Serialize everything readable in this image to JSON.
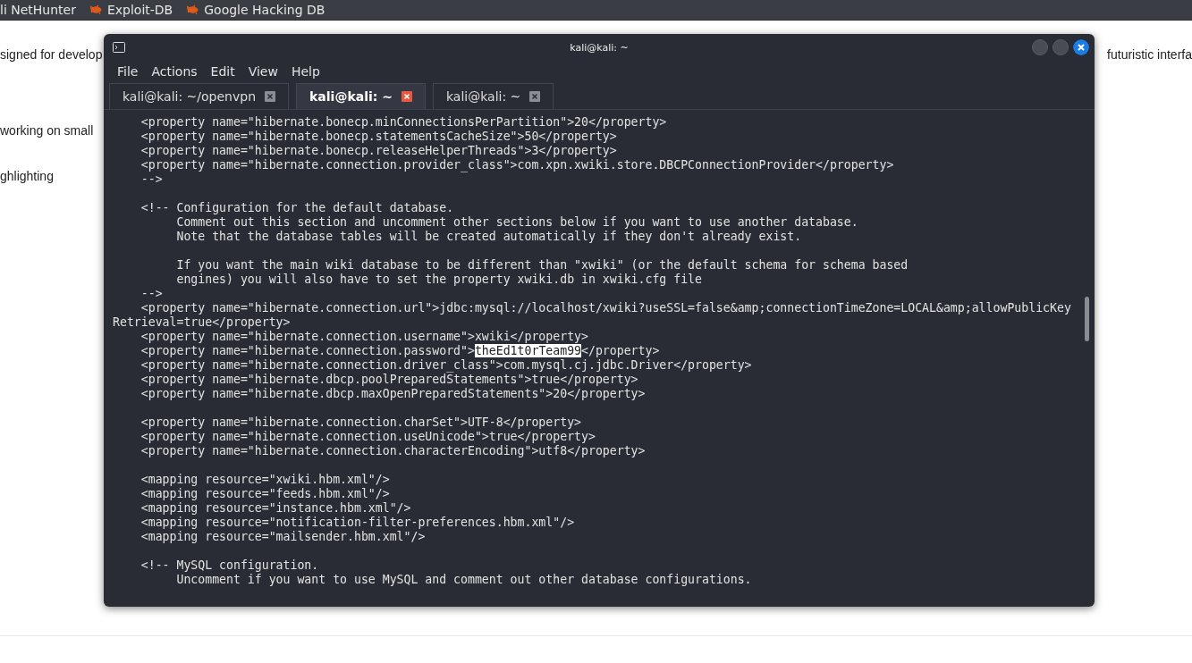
{
  "bookmarks": [
    {
      "label": "li NetHunter",
      "icon": false
    },
    {
      "label": "Exploit-DB",
      "icon": true
    },
    {
      "label": "Google Hacking DB",
      "icon": true
    }
  ],
  "page_text": [
    {
      "left": "signed for develop",
      "right": "futuristic interfa"
    },
    {
      "left": "working on small"
    },
    {
      "left": "ghlighting"
    }
  ],
  "terminal": {
    "title": "kali@kali: ~",
    "menu": [
      "File",
      "Actions",
      "Edit",
      "View",
      "Help"
    ],
    "tabs": [
      {
        "label": "kali@kali: ~/openvpn",
        "selected": false
      },
      {
        "label": "kali@kali: ~",
        "selected": true
      },
      {
        "label": "kali@kali: ~",
        "selected": false
      }
    ],
    "lines": [
      {
        "kind": "code",
        "text": "    <property name=\"hibernate.bonecp.minConnectionsPerPartition\">20</property>"
      },
      {
        "kind": "code",
        "text": "    <property name=\"hibernate.bonecp.statementsCacheSize\">50</property>"
      },
      {
        "kind": "code",
        "text": "    <property name=\"hibernate.bonecp.releaseHelperThreads\">3</property>"
      },
      {
        "kind": "code",
        "text": "    <property name=\"hibernate.connection.provider_class\">com.xpn.xwiki.store.DBCPConnectionProvider</property>"
      },
      {
        "kind": "code",
        "text": "    -->"
      },
      {
        "kind": "blank"
      },
      {
        "kind": "code",
        "text": "    <!-- Configuration for the default database."
      },
      {
        "kind": "code",
        "text": "         Comment out this section and uncomment other sections below if you want to use another database."
      },
      {
        "kind": "code",
        "text": "         Note that the database tables will be created automatically if they don't already exist."
      },
      {
        "kind": "blank"
      },
      {
        "kind": "code",
        "text": "         If you want the main wiki database to be different than \"xwiki\" (or the default schema for schema based"
      },
      {
        "kind": "code",
        "text": "         engines) you will also have to set the property xwiki.db in xwiki.cfg file"
      },
      {
        "kind": "code",
        "text": "    -->"
      },
      {
        "kind": "code",
        "text": "    <property name=\"hibernate.connection.url\">jdbc:mysql://localhost/xwiki?useSSL=false&amp;connectionTimeZone=LOCAL&amp;allowPublicKey"
      },
      {
        "kind": "code",
        "text": "Retrieval=true</property>"
      },
      {
        "kind": "code",
        "text": "    <property name=\"hibernate.connection.username\">xwiki</property>"
      },
      {
        "kind": "code",
        "text": "    <property name=\"hibernate.connection.password\">",
        "selection": "theEd1t0rTeam99",
        "after": "</property>"
      },
      {
        "kind": "code",
        "text": "    <property name=\"hibernate.connection.driver_class\">com.mysql.cj.jdbc.Driver</property>"
      },
      {
        "kind": "code",
        "text": "    <property name=\"hibernate.dbcp.poolPreparedStatements\">true</property>"
      },
      {
        "kind": "code",
        "text": "    <property name=\"hibernate.dbcp.maxOpenPreparedStatements\">20</property>"
      },
      {
        "kind": "blank"
      },
      {
        "kind": "code",
        "text": "    <property name=\"hibernate.connection.charSet\">UTF-8</property>"
      },
      {
        "kind": "code",
        "text": "    <property name=\"hibernate.connection.useUnicode\">true</property>"
      },
      {
        "kind": "code",
        "text": "    <property name=\"hibernate.connection.characterEncoding\">utf8</property>"
      },
      {
        "kind": "blank"
      },
      {
        "kind": "code",
        "text": "    <mapping resource=\"xwiki.hbm.xml\"/>"
      },
      {
        "kind": "code",
        "text": "    <mapping resource=\"feeds.hbm.xml\"/>"
      },
      {
        "kind": "code",
        "text": "    <mapping resource=\"instance.hbm.xml\"/>"
      },
      {
        "kind": "code",
        "text": "    <mapping resource=\"notification-filter-preferences.hbm.xml\"/>"
      },
      {
        "kind": "code",
        "text": "    <mapping resource=\"mailsender.hbm.xml\"/>"
      },
      {
        "kind": "blank"
      },
      {
        "kind": "code",
        "text": "    <!-- MySQL configuration."
      },
      {
        "kind": "code",
        "text": "         Uncomment if you want to use MySQL and comment out other database configurations."
      }
    ]
  }
}
